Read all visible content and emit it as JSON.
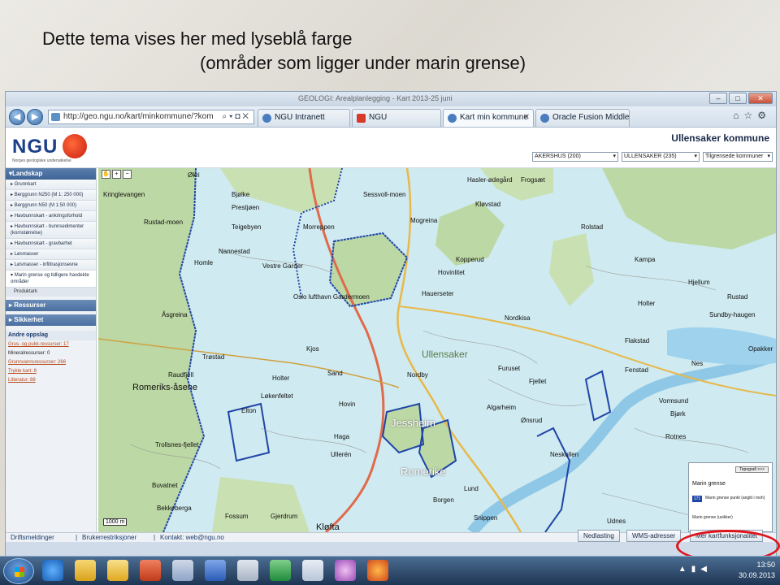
{
  "slide": {
    "title_line1": "Dette tema vises her med lyseblå farge",
    "title_line2": "(områder som ligger under marin grense)"
  },
  "browser": {
    "window_title": "GEOLOGI: Arealplanlegging - Kart 2013-25 juni",
    "address": "http://geo.ngu.no/kart/minkommune/?kom",
    "tabs": [
      {
        "label": "NGU Intranett",
        "icon": "ie-icon"
      },
      {
        "label": "NGU",
        "icon": "ngu-icon"
      },
      {
        "label": "Kart min kommune",
        "icon": "ie-icon",
        "active": true
      },
      {
        "label": "Oracle Fusion Middlew...",
        "icon": "ie-icon"
      }
    ]
  },
  "header": {
    "logo": "NGU",
    "logo_tagline": "Norges geologiske undersøkelse",
    "kommune_title": "Ullensaker kommune",
    "select_fylke": "AKERSHUS (200)",
    "select_kommune": "ULLENSAKER (235)",
    "select_neighbors": "Tilgrensede kommuner"
  },
  "sidebar": {
    "head": "Landskap",
    "items": [
      {
        "label": "Grunnkart"
      },
      {
        "label": "Berggrunn N250 (M 1: 250 000)"
      },
      {
        "label": "Berggrunn N50 (M 1:50 000)"
      },
      {
        "label": "Havbunnskart - ankringsforhold"
      },
      {
        "label": "Havbunnskart - bunnsedimenter (kornstørrelse)",
        "tall": true
      },
      {
        "label": "Havbunnskart - gravbarhet"
      },
      {
        "label": "Løsmasser"
      },
      {
        "label": "Løsmasser - infiltrasjonsevne"
      },
      {
        "label": "Marin grense og tidligere havdekte områder",
        "tall": true,
        "selected": true
      }
    ],
    "sub_item": "Produktark",
    "sections": [
      "Ressurser",
      "Sikkerhet"
    ],
    "other_head": "Andre oppslag",
    "other_links": [
      {
        "label": "Grus- og pukk-ressurser: 17",
        "link": true
      },
      {
        "label": "Mineralressurser: 0",
        "link": false
      },
      {
        "label": "Grunnvannsressurser: 266",
        "link": true
      },
      {
        "label": "Trykte kart: 8",
        "link": true
      },
      {
        "label": "Litteratur: 88",
        "link": true
      }
    ]
  },
  "map": {
    "scale": "1000 m",
    "labels": [
      {
        "text": "Økri"
      },
      {
        "text": "Kringlevangen"
      },
      {
        "text": "Bjølke"
      },
      {
        "text": "Prestjøen"
      },
      {
        "text": "Sessvoll-moen"
      },
      {
        "text": "Hasler-ødegård"
      },
      {
        "text": "Frogsæt"
      },
      {
        "text": "Teigebyen"
      },
      {
        "text": "Mogreina"
      },
      {
        "text": "Rolstad"
      },
      {
        "text": "Kløvstad"
      },
      {
        "text": "Morreppen"
      },
      {
        "text": "Rustad-moen"
      },
      {
        "text": "Nannestad"
      },
      {
        "text": "Kopperud"
      },
      {
        "text": "Hovinlitet"
      },
      {
        "text": "Homle"
      },
      {
        "text": "Vestre Garder"
      },
      {
        "text": "Oslo lufthavn Gardermoen"
      },
      {
        "text": "Hauerseter"
      },
      {
        "text": "Nordkisa"
      },
      {
        "text": "Kjos"
      },
      {
        "text": "Sand"
      },
      {
        "text": "Ullensaker"
      },
      {
        "text": "Furuset"
      },
      {
        "text": "Holter"
      },
      {
        "text": "Nordby"
      },
      {
        "text": "Løkenfeltet"
      },
      {
        "text": "Fjellet"
      },
      {
        "text": "Romeriks-åsene"
      },
      {
        "text": "Hovin"
      },
      {
        "text": "Jessheim"
      },
      {
        "text": "Algarheim"
      },
      {
        "text": "Ønsrud"
      },
      {
        "text": "Vormsund"
      },
      {
        "text": "Kampa"
      },
      {
        "text": "Holter"
      },
      {
        "text": "Sundby-haugen"
      },
      {
        "text": "Nes"
      },
      {
        "text": "Hjellum"
      },
      {
        "text": "Rustad"
      },
      {
        "text": "Romerike"
      },
      {
        "text": "Ullerén"
      },
      {
        "text": "Haga"
      },
      {
        "text": "Borgen"
      },
      {
        "text": "Kløfta"
      },
      {
        "text": "Gjerdrum"
      },
      {
        "text": "Fossum"
      },
      {
        "text": "Bekkeberga"
      },
      {
        "text": "Buvatnet"
      },
      {
        "text": "Trollsnes-fjellet"
      },
      {
        "text": "Rotnes"
      },
      {
        "text": "Udnes"
      },
      {
        "text": "Opakker"
      },
      {
        "text": "Fenstad"
      },
      {
        "text": "Flakstad"
      },
      {
        "text": "Åsgreina"
      },
      {
        "text": "Trøstad"
      },
      {
        "text": "Raudfjell"
      },
      {
        "text": "Elton"
      },
      {
        "text": "Neskollen"
      },
      {
        "text": "Snippen"
      },
      {
        "text": "Lund"
      },
      {
        "text": "Bjørk"
      }
    ],
    "legend": {
      "button": "Topografi >>>",
      "title": "Marin grense",
      "symbol": "171",
      "item": "Marin grense punkt (angitt i moh)",
      "item2": "Marin grense (usikker)"
    }
  },
  "footer": {
    "links": [
      "Driftsmeldinger",
      "Brukerrestriksjoner",
      "Kontakt: web@ngu.no"
    ],
    "buttons": [
      "Nedlasting",
      "WMS-adresser",
      "Mer kartfunksjonalitet"
    ]
  },
  "taskbar": {
    "time": "13:50",
    "date": "30.09.2013",
    "icons": [
      "ie-icon",
      "folder-icon",
      "outlook-icon",
      "powerpoint-icon",
      "word-icon",
      "calculator-icon",
      "excel-icon",
      "paint-icon",
      "firefox-icon"
    ]
  },
  "colors": {
    "marine_area": "#cfeaf0",
    "forest": "#bcd8a4",
    "marine_limit_line": "#1f45a8",
    "highlight": "#e0131b"
  }
}
